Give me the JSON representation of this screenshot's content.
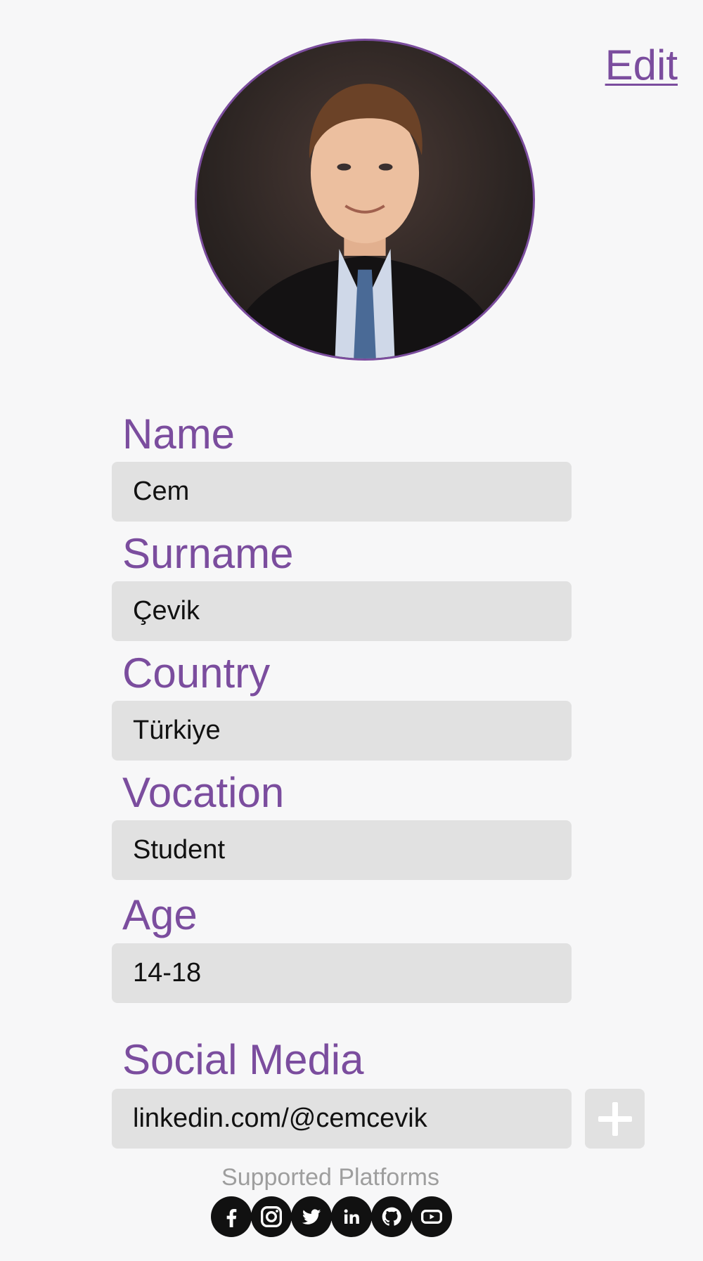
{
  "header": {
    "edit_label": "Edit"
  },
  "profile": {
    "fields": [
      {
        "label": "Name",
        "value": "Cem"
      },
      {
        "label": "Surname",
        "value": "Çevik"
      },
      {
        "label": "Country",
        "value": "Türkiye"
      },
      {
        "label": "Vocation",
        "value": "Student"
      },
      {
        "label": "Age",
        "value": "14-18"
      }
    ],
    "social": {
      "label": "Social Media",
      "value": "linkedin.com/@cemcevik"
    }
  },
  "platforms": {
    "caption": "Supported Platforms",
    "icons": [
      "facebook-icon",
      "instagram-icon",
      "twitter-icon",
      "linkedin-icon",
      "github-icon",
      "youtube-icon"
    ]
  },
  "colors": {
    "accent": "#7b4d9e",
    "field_bg": "#e1e1e1",
    "background": "#f7f7f8"
  }
}
